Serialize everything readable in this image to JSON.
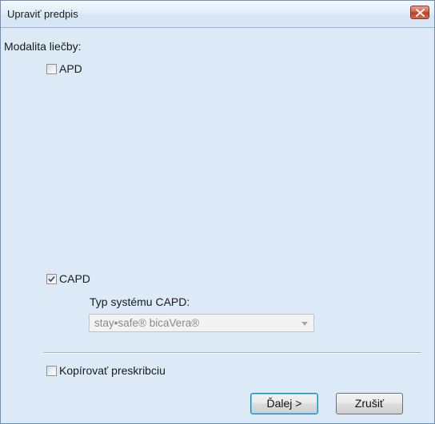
{
  "window": {
    "title": "Upraviť predpis"
  },
  "form": {
    "modality_label": "Modalita liečby:",
    "apd": {
      "label": "APD",
      "checked": false
    },
    "capd": {
      "label": "CAPD",
      "checked": true
    },
    "capd_system": {
      "label": "Typ systému CAPD:",
      "selected": "stay•safe® bicaVera®",
      "disabled": true
    },
    "copy_prescription": {
      "label": "Kopírovať preskribciu",
      "checked": false
    }
  },
  "buttons": {
    "next": "Ďalej >",
    "cancel": "Zrušiť"
  },
  "colors": {
    "dialog_bg": "#dbeaf6",
    "close_button": "#c7432a"
  }
}
